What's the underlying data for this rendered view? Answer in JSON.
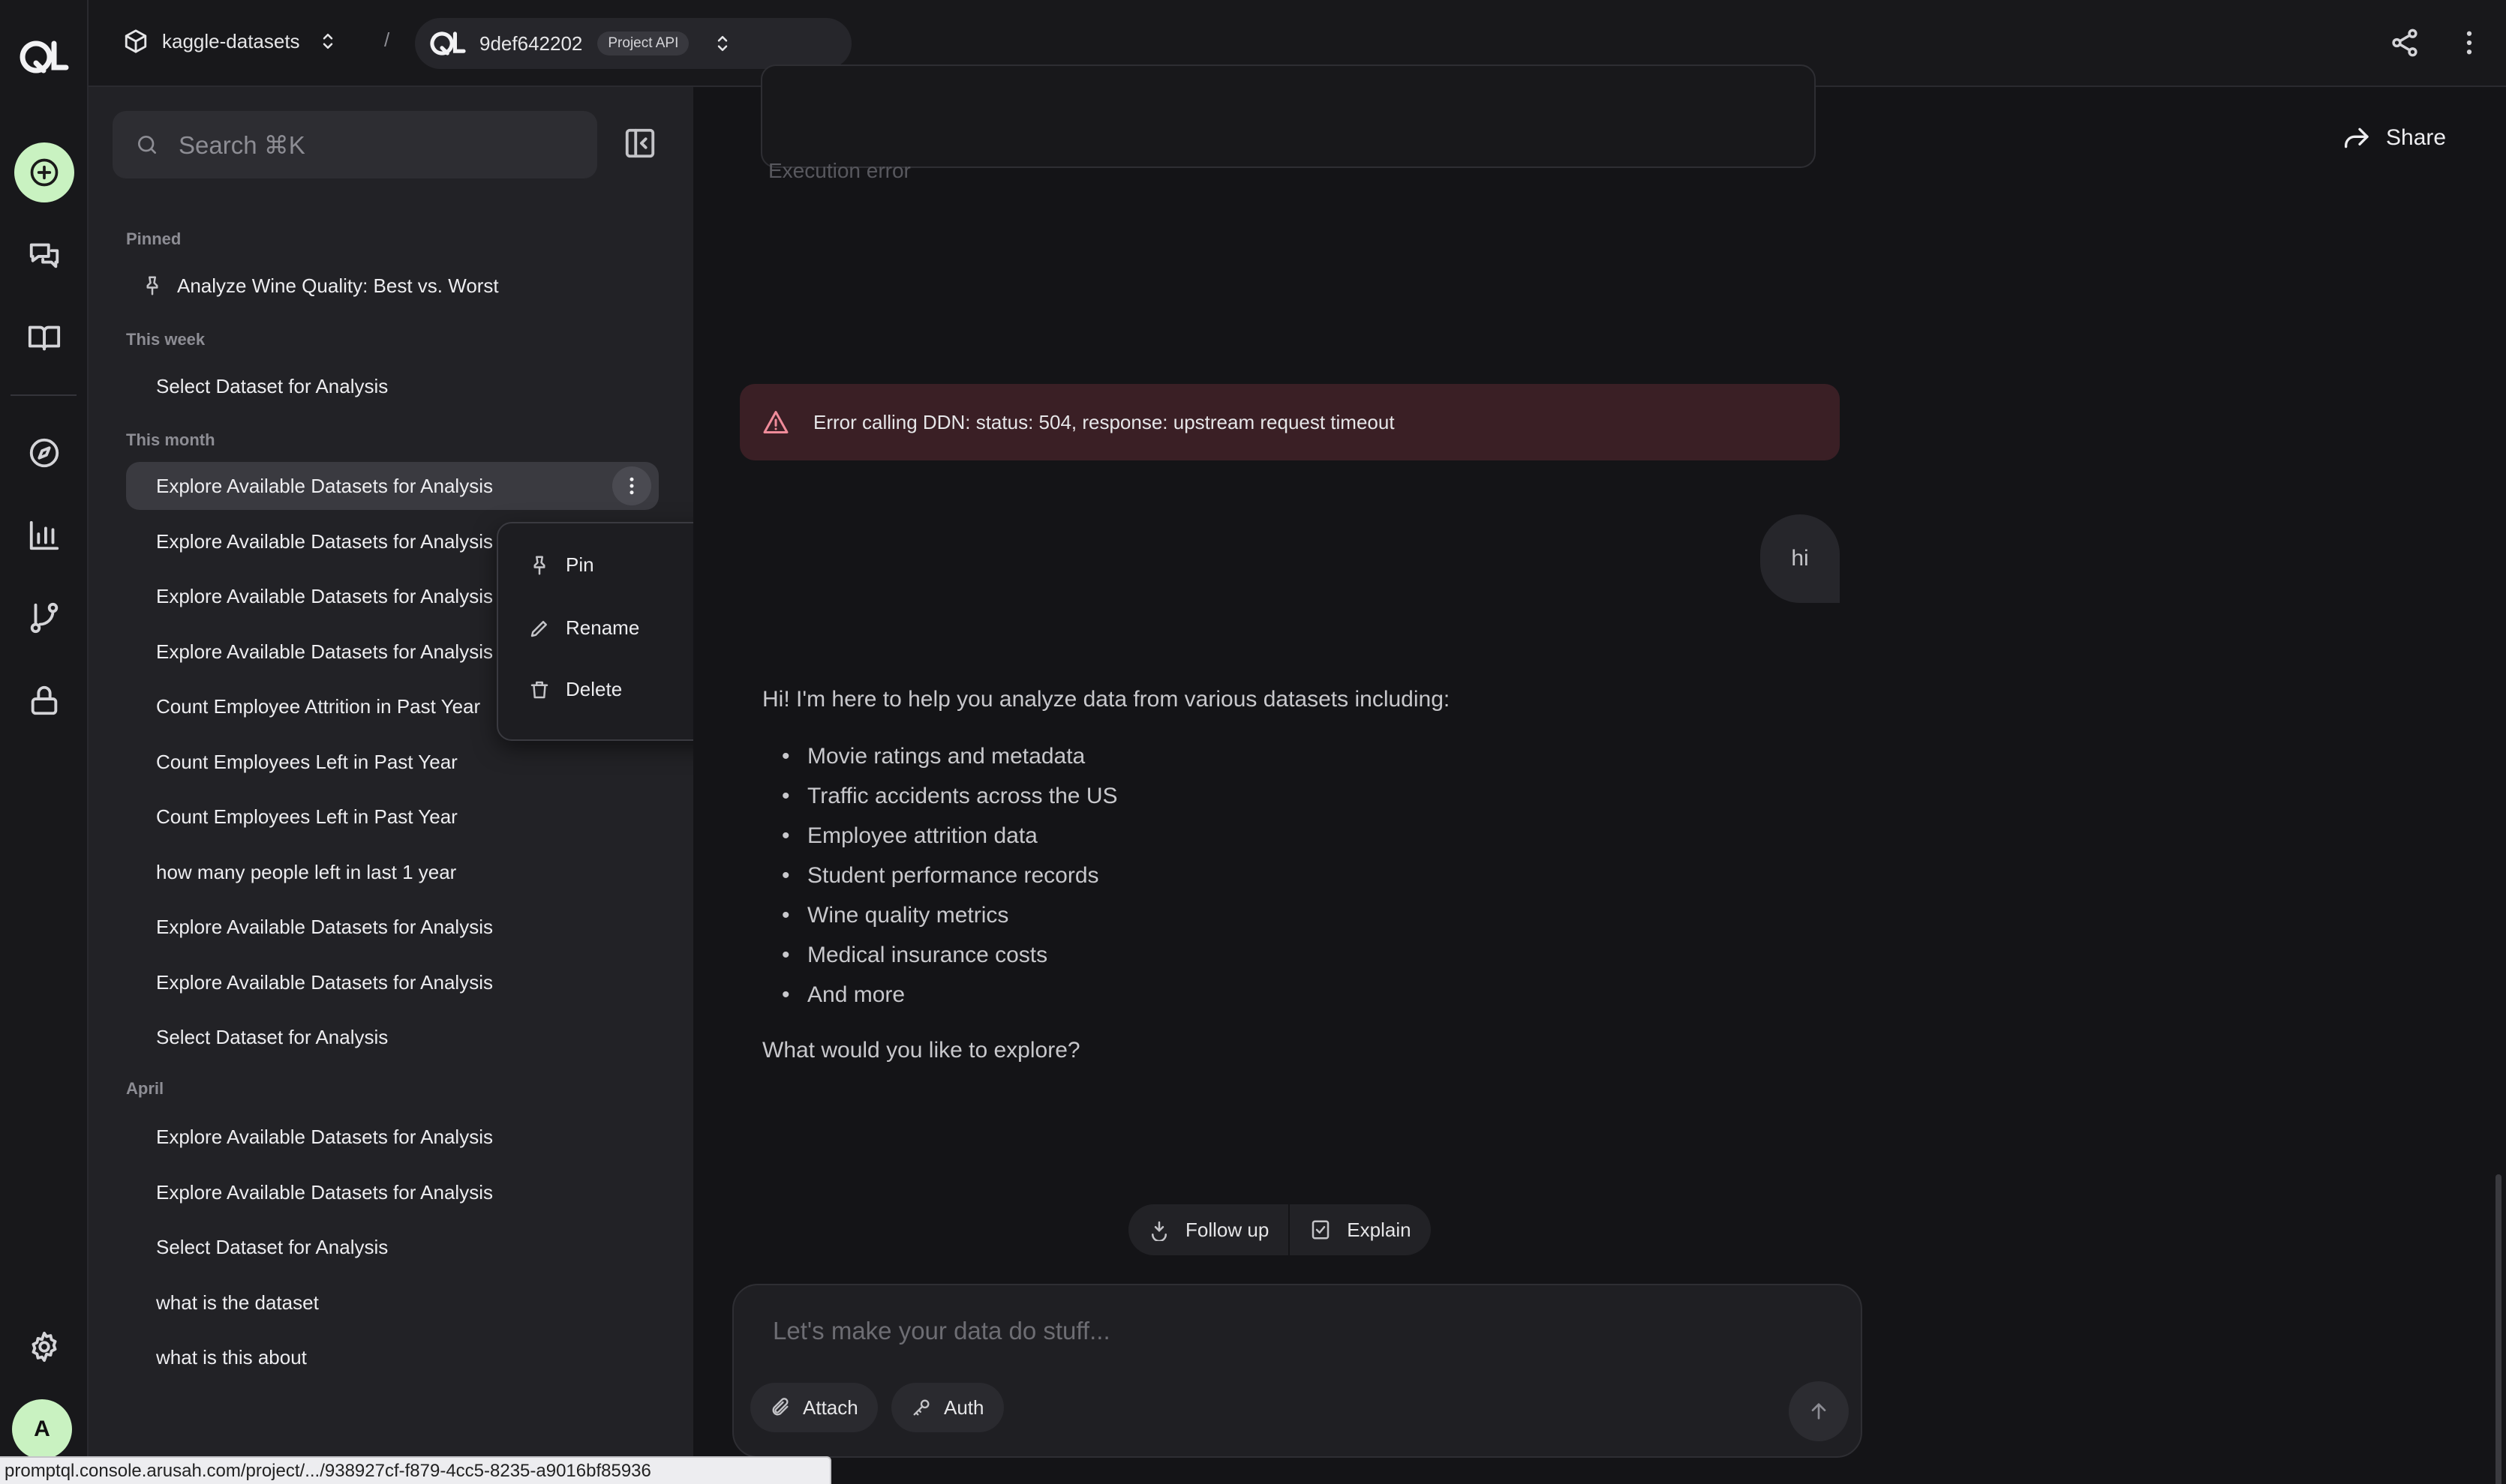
{
  "topbar": {
    "org": "kaggle-datasets",
    "separator": "/",
    "project_id": "9def642202",
    "project_badge": "Project API"
  },
  "sidebar": {
    "search_placeholder": "Search ⌘K",
    "pinned_label": "Pinned",
    "pinned_item": "Analyze Wine Quality: Best vs. Worst",
    "this_week_label": "This week",
    "this_week_items": [
      "Select Dataset for Analysis"
    ],
    "this_month_label": "This month",
    "this_month_items": [
      "Explore Available Datasets for Analysis",
      "Explore Available Datasets for Analysis",
      "Explore Available Datasets for Analysis",
      "Explore Available Datasets for Analysis",
      "Count Employee Attrition in Past Year",
      "Count Employees Left in Past Year",
      "Count Employees Left in Past Year",
      "how many people left in last 1 year",
      "Explore Available Datasets for Analysis",
      "Explore Available Datasets for Analysis",
      "Select Dataset for Analysis"
    ],
    "april_label": "April",
    "april_items": [
      "Explore Available Datasets for Analysis",
      "Explore Available Datasets for Analysis",
      "Select Dataset for Analysis",
      "what is the dataset",
      "what is this about"
    ]
  },
  "context_menu": {
    "pin": "Pin",
    "rename": "Rename",
    "delete": "Delete"
  },
  "main": {
    "share_label": "Share",
    "execution_card_label": "Execution error",
    "error_message": "Error calling DDN: status: 504, response: upstream request timeout",
    "user_message": "hi",
    "assistant_intro": "Hi! I'm here to help you analyze data from various datasets including:",
    "assistant_list": [
      "Movie ratings and metadata",
      "Traffic accidents across the US",
      "Employee attrition data",
      "Student performance records",
      "Wine quality metrics",
      "Medical insurance costs",
      "And more"
    ],
    "assistant_outro": "What would you like to explore?",
    "follow_up_label": "Follow up",
    "explain_label": "Explain"
  },
  "composer": {
    "placeholder": "Let's make your data do stuff...",
    "attach_label": "Attach",
    "auth_label": "Auth"
  },
  "user": {
    "avatar_initial": "A"
  },
  "status_url": "promptql.console.arusah.com/project/.../938927cf-f879-4cc5-8235-a9016bf85936",
  "colors": {
    "accent": "#c9f2c1",
    "error_bg": "#3a1f25",
    "error_icon": "#f08b9a"
  }
}
